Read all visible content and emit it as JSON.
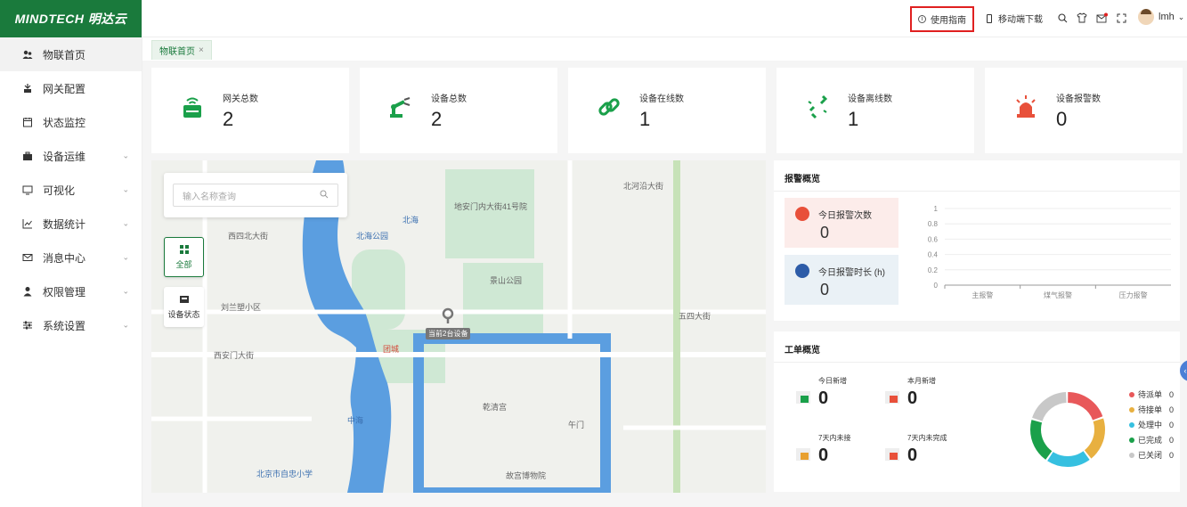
{
  "brand": {
    "logo": "MINDTECH 明达云"
  },
  "sidebar": {
    "items": [
      {
        "label": "物联首页",
        "icon": "people-icon",
        "active": true,
        "expandable": false
      },
      {
        "label": "网关配置",
        "icon": "gateway-icon",
        "active": false,
        "expandable": false
      },
      {
        "label": "状态监控",
        "icon": "calendar-icon",
        "active": false,
        "expandable": false
      },
      {
        "label": "设备运维",
        "icon": "briefcase-icon",
        "active": false,
        "expandable": true
      },
      {
        "label": "可视化",
        "icon": "monitor-icon",
        "active": false,
        "expandable": true
      },
      {
        "label": "数据统计",
        "icon": "line-chart-icon",
        "active": false,
        "expandable": true
      },
      {
        "label": "消息中心",
        "icon": "mail-icon",
        "active": false,
        "expandable": true
      },
      {
        "label": "权限管理",
        "icon": "user-icon",
        "active": false,
        "expandable": true
      },
      {
        "label": "系统设置",
        "icon": "sliders-icon",
        "active": false,
        "expandable": true
      }
    ]
  },
  "topbar": {
    "guide_label": "使用指南",
    "mobile_label": "移动端下载",
    "user_name": "lmh"
  },
  "tabs": [
    {
      "label": "物联首页"
    }
  ],
  "stats": [
    {
      "label": "网关总数",
      "value": "2",
      "icon": "router-icon"
    },
    {
      "label": "设备总数",
      "value": "2",
      "icon": "robot-arm-icon"
    },
    {
      "label": "设备在线数",
      "value": "1",
      "icon": "link-icon"
    },
    {
      "label": "设备离线数",
      "value": "1",
      "icon": "broken-link-icon"
    },
    {
      "label": "设备报警数",
      "value": "0",
      "icon": "alarm-light-icon"
    }
  ],
  "map": {
    "search_placeholder": "输入名称查询",
    "all_label": "全部",
    "status_label": "设备状态",
    "marker_label": "当前2台设备",
    "labels": [
      {
        "text": "北海",
        "cls": "blue"
      },
      {
        "text": "北海公园",
        "cls": "blue"
      },
      {
        "text": "景山公园",
        "cls": ""
      },
      {
        "text": "故宫博物院",
        "cls": ""
      },
      {
        "text": "西四北大街",
        "cls": ""
      },
      {
        "text": "北河沿大街",
        "cls": ""
      },
      {
        "text": "五四大街",
        "cls": ""
      },
      {
        "text": "西安门大街",
        "cls": ""
      },
      {
        "text": "中海",
        "cls": "blue"
      },
      {
        "text": "团城",
        "cls": "red"
      },
      {
        "text": "乾清宫",
        "cls": ""
      },
      {
        "text": "午门",
        "cls": ""
      },
      {
        "text": "刘兰塑小区",
        "cls": ""
      },
      {
        "text": "地安门内大街41号院",
        "cls": ""
      },
      {
        "text": "北京市自忠小学",
        "cls": "blue"
      }
    ]
  },
  "alarm_overview": {
    "title": "报警概览",
    "today_count_label": "今日报警次数",
    "today_count_value": "0",
    "today_duration_label": "今日报警时长 (h)",
    "today_duration_value": "0"
  },
  "chart_data": {
    "type": "bar",
    "categories": [
      "主报警",
      "煤气报警",
      "压力报警"
    ],
    "values": [
      0,
      0,
      0
    ],
    "ylim": [
      0,
      1
    ],
    "yticks": [
      "1",
      "0.8",
      "0.6",
      "0.4",
      "0.2",
      "0"
    ],
    "grid": true
  },
  "work_order": {
    "title": "工单概览",
    "items": [
      {
        "label": "今日新增",
        "value": "0",
        "icon": "calendar-green-icon"
      },
      {
        "label": "本月新增",
        "value": "0",
        "icon": "calendar-red-icon"
      },
      {
        "label": "7天内未接",
        "value": "0",
        "icon": "hourglass-icon"
      },
      {
        "label": "7天内未完成",
        "value": "0",
        "icon": "calendar-x-icon"
      }
    ],
    "legend": [
      {
        "label": "待派单",
        "value": "0",
        "color": "#e8585a"
      },
      {
        "label": "待接单",
        "value": "0",
        "color": "#e8b040"
      },
      {
        "label": "处理中",
        "value": "0",
        "color": "#36c0e0"
      },
      {
        "label": "已完成",
        "value": "0",
        "color": "#1aa04a"
      },
      {
        "label": "已关闭",
        "value": "0",
        "color": "#c8c8c8"
      }
    ]
  }
}
